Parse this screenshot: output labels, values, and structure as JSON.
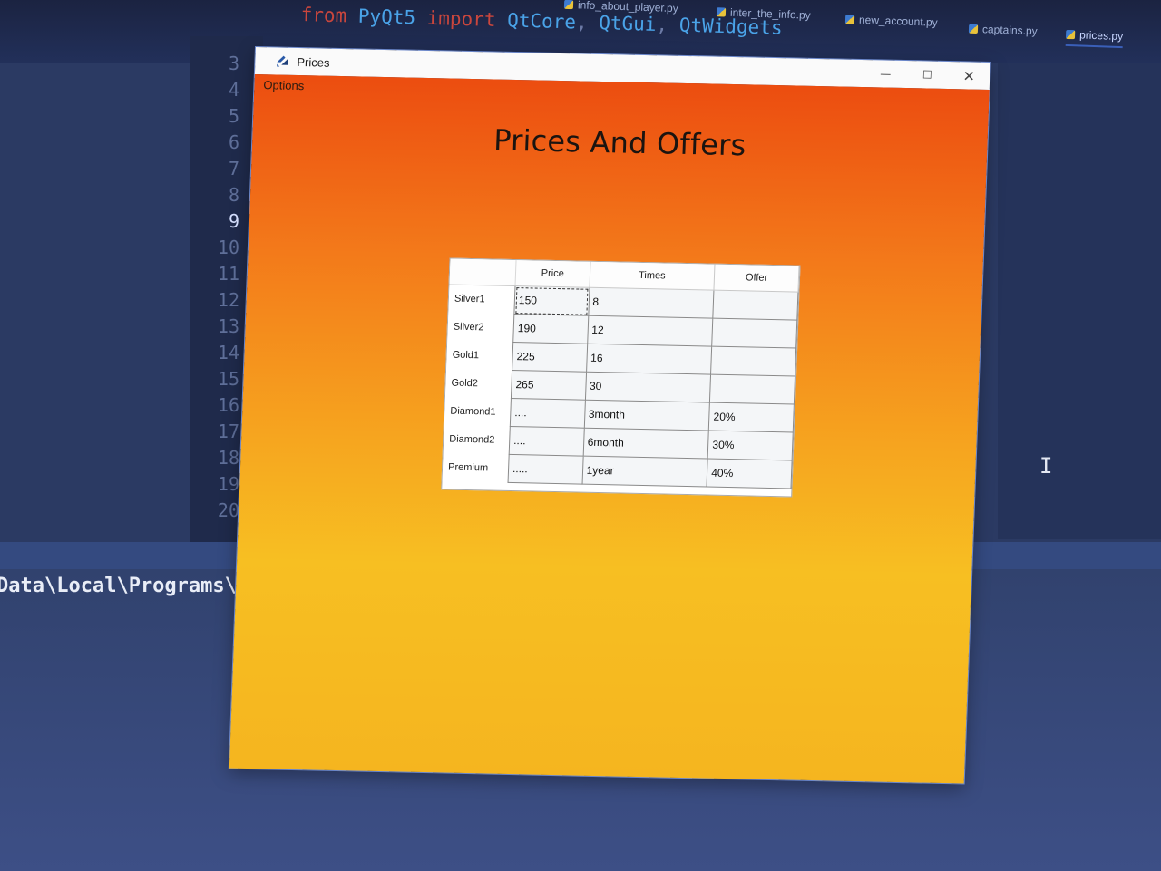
{
  "editor": {
    "code_parts": [
      "from",
      " PyQt5 ",
      "import",
      " QtCore",
      ",",
      " QtGui",
      ",",
      " QtWidgets"
    ],
    "tabs": [
      "info_about_player.py",
      "inter_the_info.py",
      "new_account.py",
      "captains.py",
      "prices.py"
    ],
    "active_tab": "prices.py",
    "line_numbers": [
      "3",
      "4",
      "5",
      "6",
      "7",
      "8",
      "9",
      "10",
      "11",
      "12",
      "13",
      "14",
      "15",
      "16",
      "17",
      "18",
      "19",
      "20"
    ],
    "current_line": "9",
    "terminal_text": "Data\\Local\\Programs\\Py"
  },
  "window": {
    "title": "Prices",
    "menu_options": "Options",
    "heading": "Prices And Offers",
    "controls": {
      "minimize": "—",
      "maximize": "☐",
      "close": "✕"
    }
  },
  "table": {
    "columns": [
      "Price",
      "Times",
      "Offer"
    ],
    "rows": [
      {
        "label": "Silver1",
        "price": "150",
        "times": "8",
        "offer": ""
      },
      {
        "label": "Silver2",
        "price": "190",
        "times": "12",
        "offer": ""
      },
      {
        "label": "Gold1",
        "price": "225",
        "times": "16",
        "offer": ""
      },
      {
        "label": "Gold2",
        "price": "265",
        "times": "30",
        "offer": ""
      },
      {
        "label": "Diamond1",
        "price": "....",
        "times": "3month",
        "offer": "20%"
      },
      {
        "label": "Diamond2",
        "price": "....",
        "times": "6month",
        "offer": "30%"
      },
      {
        "label": "Premium",
        "price": ".....",
        "times": "1year",
        "offer": "40%"
      }
    ]
  },
  "colors": {
    "gradient_top": "#ec4d10",
    "gradient_bottom": "#f7bf22",
    "ide_background": "#2b3a63"
  }
}
